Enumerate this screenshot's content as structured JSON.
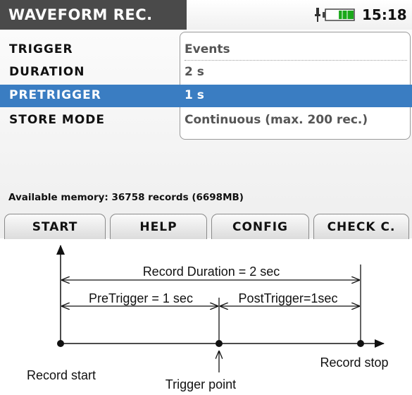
{
  "header": {
    "title": "WAVEFORM REC.",
    "time": "15:18",
    "battery_level": 0.55
  },
  "settings": [
    {
      "label": "TRIGGER",
      "value": "Events",
      "selected": false
    },
    {
      "label": "DURATION",
      "value": "2 s",
      "selected": false
    },
    {
      "label": "PRETRIGGER",
      "value": "1 s",
      "selected": true
    },
    {
      "label": "STORE MODE",
      "value": "Continuous (max. 200 rec.)",
      "selected": false
    }
  ],
  "memory": {
    "text": "Available memory: 36758 records (6698MB)"
  },
  "function_keys": [
    "START",
    "HELP",
    "CONFIG",
    "CHECK C."
  ],
  "diagram": {
    "record_duration": "Record Duration = 2 sec",
    "pretrigger": "PreTrigger = 1 sec",
    "posttrigger": "PostTrigger=1sec",
    "record_start": "Record start",
    "trigger_point": "Trigger point",
    "record_stop": "Record stop"
  },
  "colors": {
    "title_bg": "#4a4a4a",
    "highlight": "#3a7dc2"
  }
}
